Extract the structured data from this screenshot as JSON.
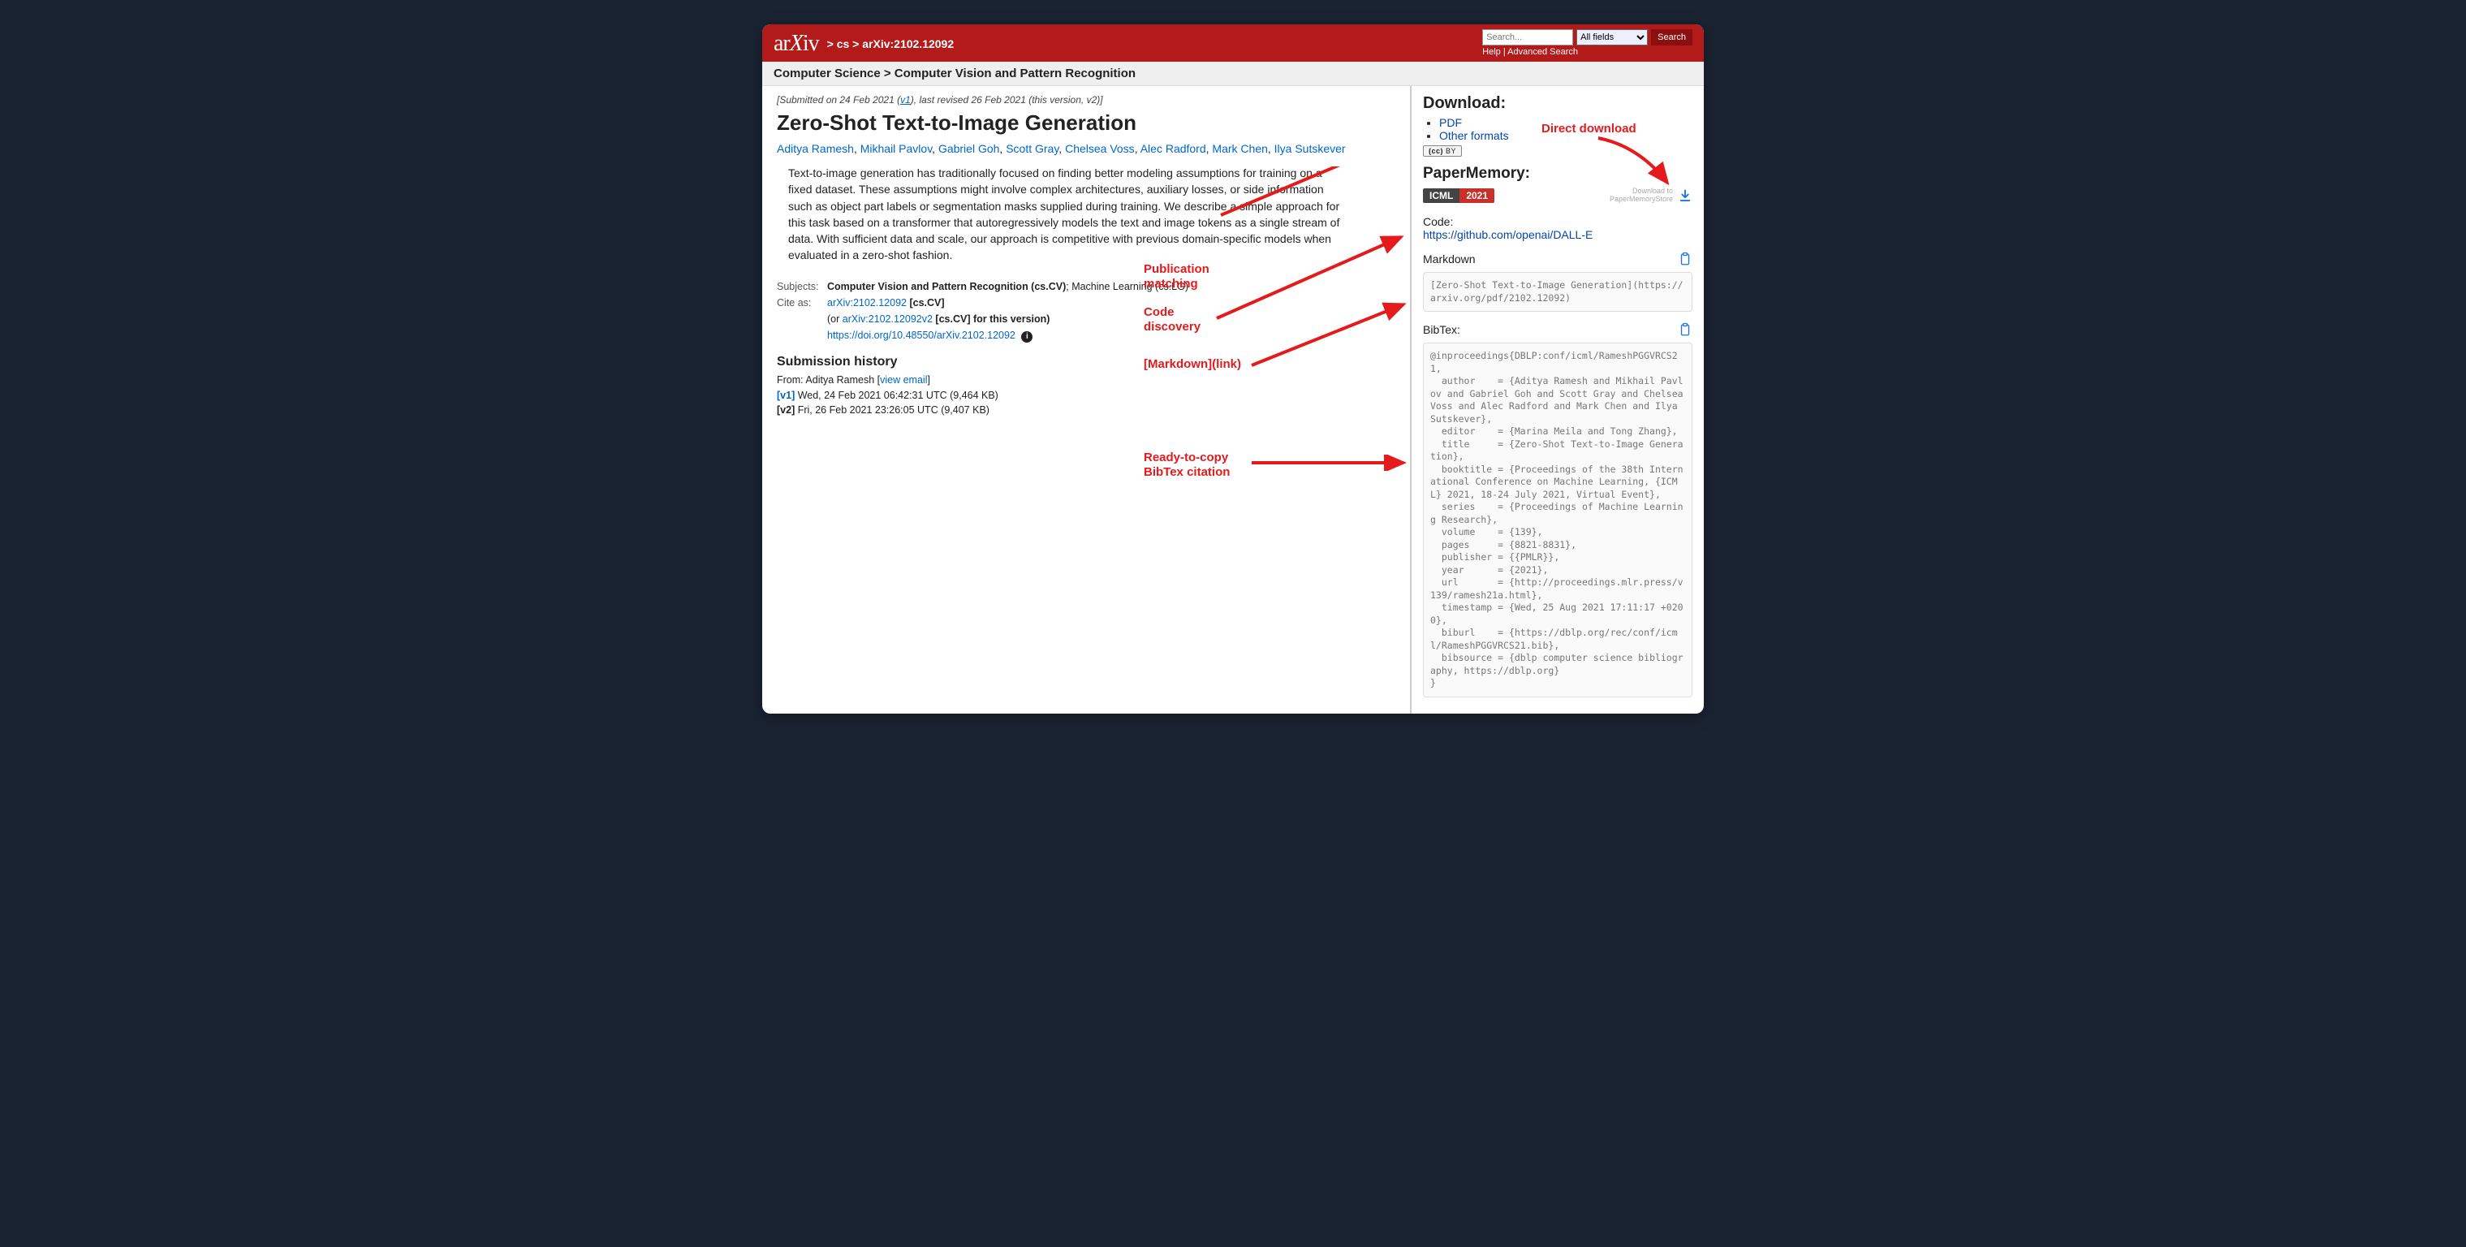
{
  "header": {
    "logo_text": "arXiv",
    "breadcrumb": "> cs > arXiv:2102.12092",
    "search_placeholder": "Search...",
    "search_field_label": "All fields",
    "search_button": "Search",
    "help": "Help",
    "advanced": "Advanced Search"
  },
  "subject_line": "Computer Science > Computer Vision and Pattern Recognition",
  "submitted_line_pre": "[Submitted on 24 Feb 2021 (",
  "submitted_v1": "v1",
  "submitted_line_post": "), last revised 26 Feb 2021 (this version, v2)]",
  "title": "Zero-Shot Text-to-Image Generation",
  "authors": [
    "Aditya Ramesh",
    "Mikhail Pavlov",
    "Gabriel Goh",
    "Scott Gray",
    "Chelsea Voss",
    "Alec Radford",
    "Mark Chen",
    "Ilya Sutskever"
  ],
  "abstract": "Text-to-image generation has traditionally focused on finding better modeling assumptions for training on a fixed dataset. These assumptions might involve complex architectures, auxiliary losses, or side information such as object part labels or segmentation masks supplied during training. We describe a simple approach for this task based on a transformer that autoregressively models the text and image tokens as a single stream of data. With sufficient data and scale, our approach is competitive with previous domain-specific models when evaluated in a zero-shot fashion.",
  "meta": {
    "subjects_label": "Subjects:",
    "subjects_bold": "Computer Vision and Pattern Recognition (cs.CV)",
    "subjects_rest": "; Machine Learning (cs.LG)",
    "cite_label": "Cite as:",
    "cite_link": "arXiv:2102.12092",
    "cite_suffix": " [cs.CV]",
    "cite_or": "(or ",
    "cite_v2": "arXiv:2102.12092v2",
    "cite_v2_suffix": " [cs.CV] for this version)",
    "doi": "https://doi.org/10.48550/arXiv.2102.12092"
  },
  "subhist": {
    "heading": "Submission history",
    "from_pre": "From: Aditya Ramesh [",
    "view_email": "view email",
    "from_post": "]",
    "v1_label": "[v1]",
    "v1_rest": " Wed, 24 Feb 2021 06:42:31 UTC (9,464 KB)",
    "v2_label": "[v2]",
    "v2_rest": " Fri, 26 Feb 2021 23:26:05 UTC (9,407 KB)"
  },
  "sidebar": {
    "download_h": "Download:",
    "pdf": "PDF",
    "other": "Other formats",
    "cc": "CC BY",
    "pm_h": "PaperMemory:",
    "venue_name": "ICML",
    "venue_year": "2021",
    "dl_to": "Download to\nPaperMemoryStore",
    "code_h": "Code:",
    "code_url": "https://github.com/openai/DALL-E",
    "md_h": "Markdown",
    "md_text": "[Zero-Shot Text-to-Image Generation](https://arxiv.org/pdf/2102.12092)",
    "bib_h": "BibTex:",
    "bib_text": "@inproceedings{DBLP:conf/icml/RameshPGGVRCS21,\n  author    = {Aditya Ramesh and Mikhail Pavlov and Gabriel Goh and Scott Gray and Chelsea Voss and Alec Radford and Mark Chen and Ilya Sutskever},\n  editor    = {Marina Meila and Tong Zhang},\n  title     = {Zero-Shot Text-to-Image Generation},\n  booktitle = {Proceedings of the 38th International Conference on Machine Learning, {ICML} 2021, 18-24 July 2021, Virtual Event},\n  series    = {Proceedings of Machine Learning Research},\n  volume    = {139},\n  pages     = {8821-8831},\n  publisher = {{PMLR}},\n  year      = {2021},\n  url       = {http://proceedings.mlr.press/v139/ramesh21a.html},\n  timestamp = {Wed, 25 Aug 2021 17:11:17 +0200},\n  biburl    = {https://dblp.org/rec/conf/icml/RameshPGGVRCS21.bib},\n  bibsource = {dblp computer science bibliography, https://dblp.org}\n}"
  },
  "annotations": {
    "direct_download": "Direct download",
    "pub_match": "Publication\nmatching",
    "code_disc": "Code\ndiscovery",
    "md_link": "[Markdown](link)",
    "bibtex": "Ready-to-copy\nBibTex citation"
  }
}
